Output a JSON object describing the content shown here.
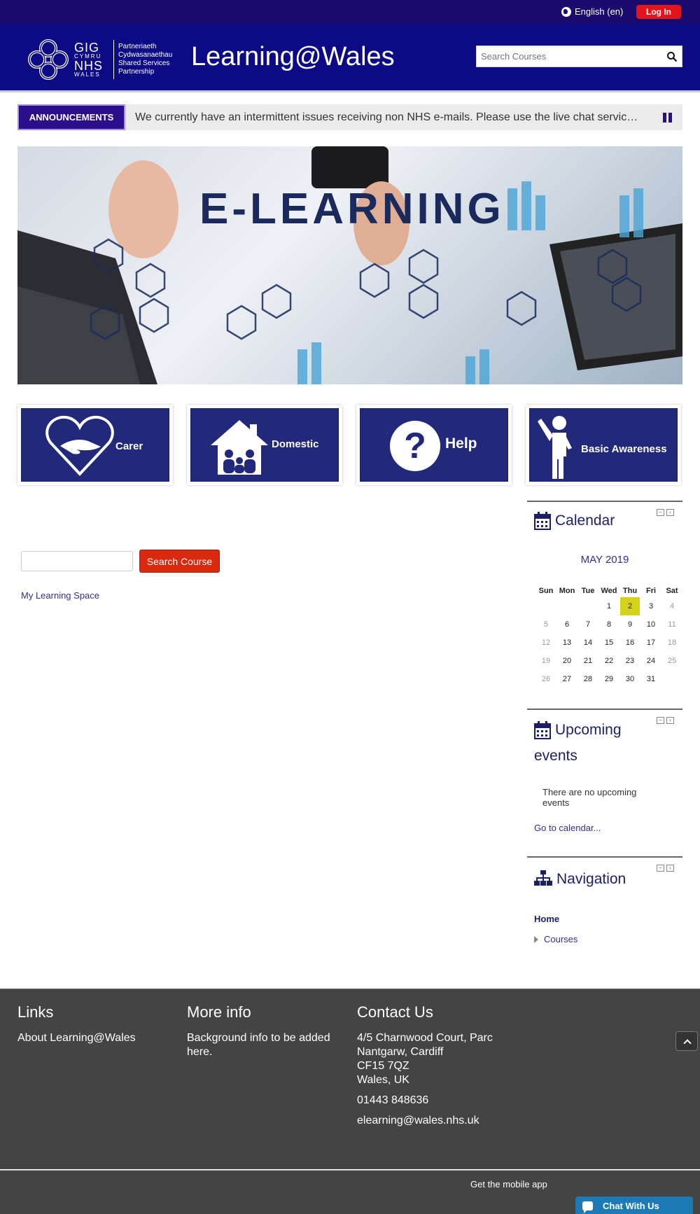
{
  "topbar": {
    "language": "English (en)",
    "login": "Log In"
  },
  "header": {
    "logo": {
      "gig": "GIG",
      "cymru": "CYMRU",
      "nhs": "NHS",
      "wales": "WALES",
      "partner_lines": [
        "Partneriaeth",
        "Cydwasanaethau",
        "Shared Services",
        "Partnership"
      ]
    },
    "title": "Learning@Wales",
    "search_placeholder": "Search Courses"
  },
  "announcements": {
    "label": "ANNOUNCEMENTS",
    "text": "We currently have an intermittent issues receiving non NHS e-mails.  Please use the live chat service un..."
  },
  "banner": {
    "title": "E-LEARNING"
  },
  "tiles": [
    {
      "label": "Carer"
    },
    {
      "label": "Domestic"
    },
    {
      "label": "Help"
    },
    {
      "label": "Basic Awareness"
    }
  ],
  "main": {
    "search_button": "Search Course",
    "my_learning_space": "My Learning Space"
  },
  "calendar": {
    "title": "Calendar",
    "month": "MAY 2019",
    "days": [
      "Sun",
      "Mon",
      "Tue",
      "Wed",
      "Thu",
      "Fri",
      "Sat"
    ],
    "weeks": [
      [
        "",
        "",
        "",
        "1",
        "2",
        "3",
        "4"
      ],
      [
        "5",
        "6",
        "7",
        "8",
        "9",
        "10",
        "11"
      ],
      [
        "12",
        "13",
        "14",
        "15",
        "16",
        "17",
        "18"
      ],
      [
        "19",
        "20",
        "21",
        "22",
        "23",
        "24",
        "25"
      ],
      [
        "26",
        "27",
        "28",
        "29",
        "30",
        "31",
        ""
      ]
    ],
    "today": "2",
    "today_color": "#d4d219"
  },
  "upcoming": {
    "title_line1": "Upcoming",
    "title_line2": "events",
    "empty_text": "There are no upcoming events",
    "link": "Go to calendar..."
  },
  "navigation": {
    "title": "Navigation",
    "home": "Home",
    "courses": "Courses"
  },
  "footer": {
    "links_title": "Links",
    "about": "About Learning@Wales",
    "more_title": "More info",
    "more_text": "Background info to be added here.",
    "contact_title": "Contact Us",
    "address_lines": [
      "4/5 Charnwood Court, Parc",
      "Nantgarw, Cardiff",
      "CF15 7QZ",
      "Wales, UK"
    ],
    "phone": "01443 848636",
    "email": "elearning@wales.nhs.uk",
    "mobile_app": "Get the mobile app",
    "chat": "Chat With Us"
  },
  "colors": {
    "topbar": "#1a0a6e",
    "header": "#0c0a85",
    "login": "#e4141b",
    "tile": "#22287a",
    "search_button": "#d9290f",
    "footer": "#444444",
    "chat": "#1d7ab5"
  },
  "icons": [
    "globe-icon",
    "search-icon",
    "pause-icon",
    "heart-hands-icon",
    "house-family-icon",
    "question-icon",
    "person-waving-icon",
    "calendar-icon",
    "sitemap-icon",
    "chevron-up-icon",
    "chat-bubble-icon"
  ]
}
